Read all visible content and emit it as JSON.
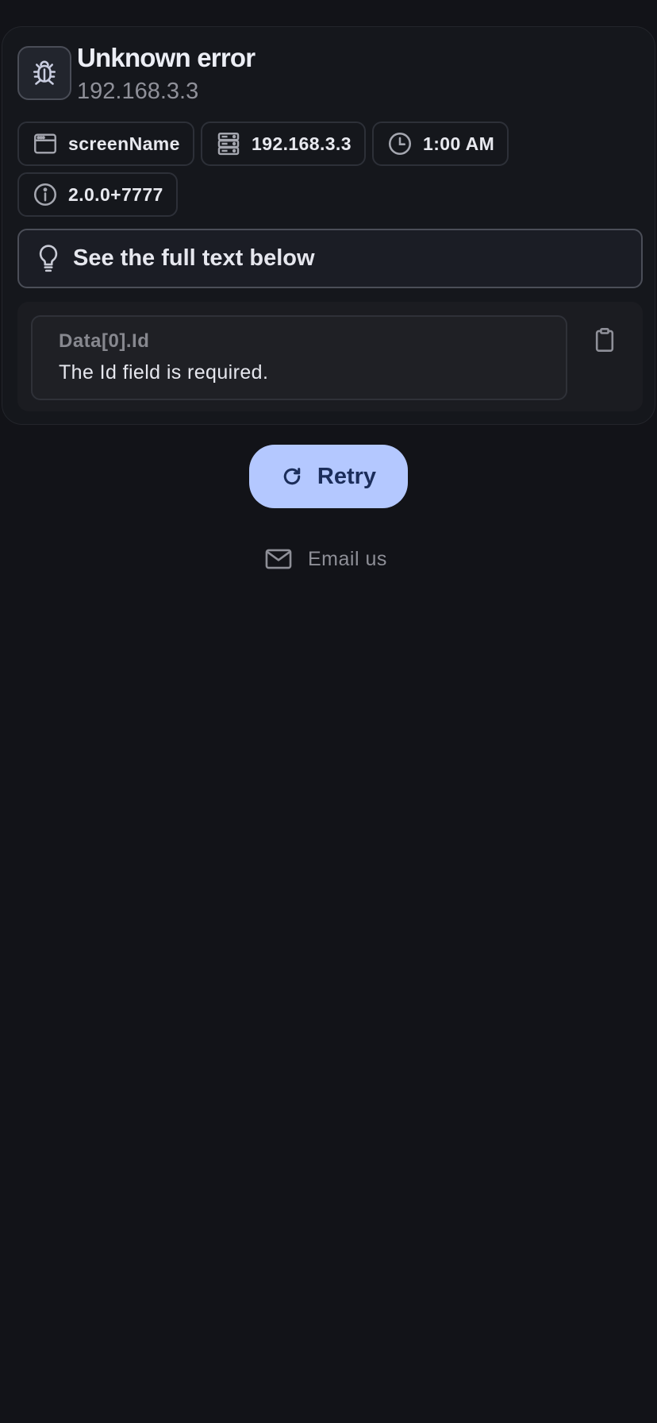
{
  "error": {
    "title": "Unknown error",
    "subtitle": "192.168.3.3",
    "icon": "bug-icon"
  },
  "chips": [
    {
      "icon": "window-icon",
      "label": "screenName"
    },
    {
      "icon": "server-icon",
      "label": "192.168.3.3"
    },
    {
      "icon": "clock-icon",
      "label": "1:00 AM"
    },
    {
      "icon": "info-icon",
      "label": "2.0.0+7777"
    }
  ],
  "hint": {
    "icon": "lightbulb-icon",
    "text": "See the full text below"
  },
  "details": [
    {
      "key": "Data[0].Id",
      "message": "The Id field is required."
    }
  ],
  "actions": {
    "retry_label": "Retry",
    "email_label": "Email us"
  },
  "colors": {
    "background": "#121318",
    "card": "#15171c",
    "accent": "#b4c8ff",
    "accent_text": "#1b2d5a",
    "muted_text": "#8f9099"
  }
}
